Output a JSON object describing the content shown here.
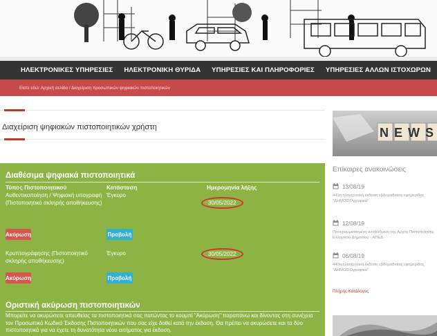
{
  "nav": {
    "items": [
      {
        "label": "ΗΛΕΚΤΡΟΝΙΚΕΣ ΥΠΗΡΕΣΙΕΣ"
      },
      {
        "label": "ΗΛΕΚΤΡΟΝΙΚΗ ΘΥΡΙΔΑ"
      },
      {
        "label": "ΥΠΗΡΕΣΙΕΣ ΚΑΙ ΠΛΗΡΟΦΟΡΙΕΣ"
      },
      {
        "label": "ΥΠΗΡΕΣΙΕΣ ΑΛΛΩΝ ΙΣΤΟΧΩΡΩΝ"
      }
    ]
  },
  "breadcrumb": "Είστε εδώ: Αρχική σελίδα / Διαχείριση προσωπικών ψηφιακών πιστοποιητικών",
  "page_title": "Διαχείριση ψηφιακών πιστοποιητικών χρήστη",
  "certificates": {
    "title": "Διαθέσιμα ψηφιακά πιστοποιητικά",
    "headers": {
      "type": "Τύπος Πιστοποιητικού",
      "status": "Κατάσταση",
      "expiry": "Ημερομηνία λήξης"
    },
    "rows": [
      {
        "type": "Αυθεντικοποίηση / Ψηφιακή υπογραφή (Πιστοποιητικό σκληρής αποθήκευσης)",
        "status": "Έγκυρο",
        "expiry": "30/05/2022",
        "revoke_label": "Ακύρωση",
        "view_label": "Προβολή"
      },
      {
        "type": "Κρυπτογράφησης (Πιστοποιητικό σκληρής αποθήκευσης)",
        "status": "Έγκυρο",
        "expiry": "30/05/2022",
        "revoke_label": "Ακύρωση",
        "view_label": "Προβολή"
      }
    ]
  },
  "revocation": {
    "title": "Οριστική ακύρωση πιστοποιητικών",
    "text": "Μπορείτε να ακυρώσετε απευθείας τα πιστοποιητικά σας πατώντας το κουμπί \"Ακύρωση\" παραπάνω και δίνοντας στη συνέχεια τον Προσωπικό Κωδικό Έκδοσης Πιστοποιητικών που σας είχε δοθεί κατά την έκδοση. Θα πρέπει να ακυρώσετε και τα δύο πιστοποιητικά για να έχετε τη δυνατότητα νέου αιτήματος για έκδοση."
  },
  "sidebar": {
    "news_image_text": "NEWS",
    "title": "Επίκαιρες ανακοινώσεις",
    "items": [
      {
        "date": "13/08/19",
        "text": "441η ηλεκτρονική έκδοση εβδομαδιαίας εφημερίδας \"ΔΗΜΟΣΙΟγραφικά\""
      },
      {
        "date": "12/08/19",
        "text": "Προγραμματισμένη αναβάθμιση της Αρχής Πιστοποίησης Ελληνικού Δημοσίου - ΑΠΕΔ"
      },
      {
        "date": "06/08/19",
        "text": "440η ηλεκτρονική έκδοση εβδομαδιαίας εφημερίδας \"ΔΗΜΟΣΙΟγραφικά\""
      }
    ],
    "catalog_link": "Πλήρης Κατάλογος"
  },
  "colors": {
    "nav_bg": "#353535",
    "breadcrumb_bg": "#c94a4a",
    "panel_green": "#8cb343",
    "revoke_red": "#d9534f",
    "view_blue": "#31b0d5",
    "highlight_ellipse": "#d0342c"
  },
  "icons": [
    "calendar-icon"
  ]
}
